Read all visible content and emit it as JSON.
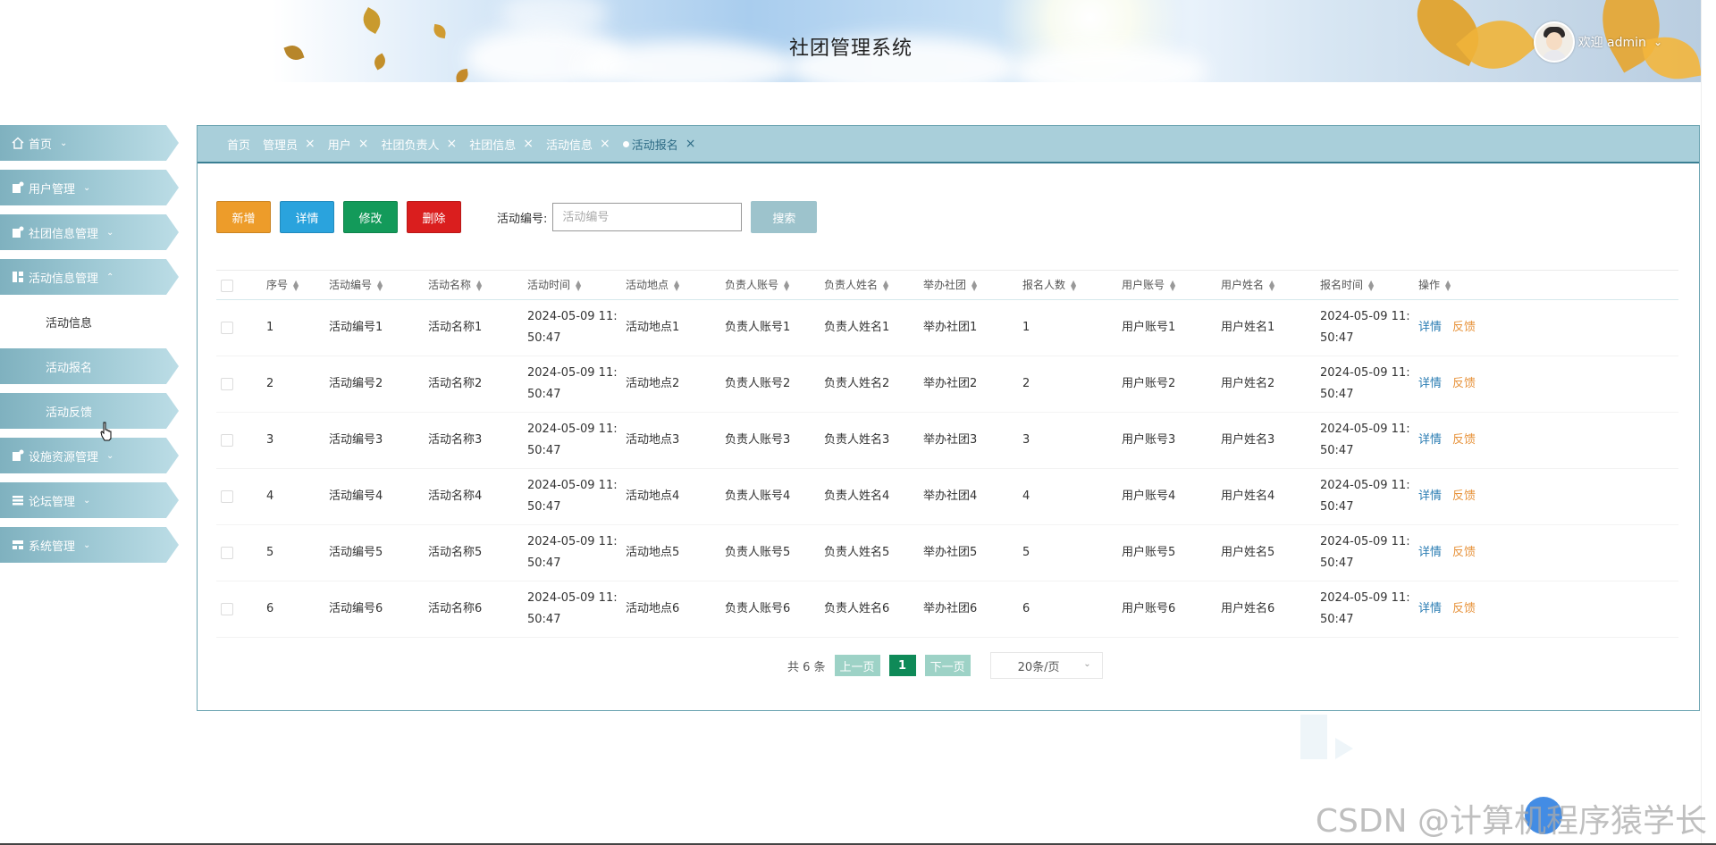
{
  "app": {
    "title": "社团管理系统",
    "welcome": "欢迎 admin"
  },
  "sidebar": {
    "items": [
      {
        "label": "首页",
        "icon": "home-icon"
      },
      {
        "label": "用户管理",
        "icon": "user-icon"
      },
      {
        "label": "社团信息管理",
        "icon": "club-icon"
      },
      {
        "label": "活动信息管理",
        "icon": "grid-icon"
      },
      {
        "label": "设施资源管理",
        "icon": "facility-icon"
      },
      {
        "label": "论坛管理",
        "icon": "list-icon"
      },
      {
        "label": "系统管理",
        "icon": "system-icon"
      }
    ],
    "submenu": [
      {
        "label": "活动信息"
      },
      {
        "label": "活动报名"
      },
      {
        "label": "活动反馈"
      }
    ]
  },
  "tabs": [
    {
      "label": "首页"
    },
    {
      "label": "管理员"
    },
    {
      "label": "用户"
    },
    {
      "label": "社团负责人"
    },
    {
      "label": "社团信息"
    },
    {
      "label": "活动信息"
    },
    {
      "label": "活动报名"
    }
  ],
  "toolbar": {
    "add": "新增",
    "detail": "详情",
    "edit": "修改",
    "delete": "删除",
    "search_label": "活动编号:",
    "search_placeholder": "活动编号",
    "search_button": "搜索"
  },
  "table": {
    "headers": [
      "序号",
      "活动编号",
      "活动名称",
      "活动时间",
      "活动地点",
      "负责人账号",
      "负责人姓名",
      "举办社团",
      "报名人数",
      "用户账号",
      "用户姓名",
      "报名时间",
      "操作"
    ],
    "rows": [
      {
        "seq": "1",
        "code": "活动编号1",
        "name": "活动名称1",
        "time1": "2024-05-09 11:",
        "time2": "50:47",
        "place": "活动地点1",
        "leader_acc": "负责人账号1",
        "leader_name": "负责人姓名1",
        "club": "举办社团1",
        "count": "1",
        "user_acc": "用户账号1",
        "user_name": "用户姓名1",
        "rtime1": "2024-05-09 11:",
        "rtime2": "50:47",
        "op_detail": "详情",
        "op_feedback": "反馈"
      },
      {
        "seq": "2",
        "code": "活动编号2",
        "name": "活动名称2",
        "time1": "2024-05-09 11:",
        "time2": "50:47",
        "place": "活动地点2",
        "leader_acc": "负责人账号2",
        "leader_name": "负责人姓名2",
        "club": "举办社团2",
        "count": "2",
        "user_acc": "用户账号2",
        "user_name": "用户姓名2",
        "rtime1": "2024-05-09 11:",
        "rtime2": "50:47",
        "op_detail": "详情",
        "op_feedback": "反馈"
      },
      {
        "seq": "3",
        "code": "活动编号3",
        "name": "活动名称3",
        "time1": "2024-05-09 11:",
        "time2": "50:47",
        "place": "活动地点3",
        "leader_acc": "负责人账号3",
        "leader_name": "负责人姓名3",
        "club": "举办社团3",
        "count": "3",
        "user_acc": "用户账号3",
        "user_name": "用户姓名3",
        "rtime1": "2024-05-09 11:",
        "rtime2": "50:47",
        "op_detail": "详情",
        "op_feedback": "反馈"
      },
      {
        "seq": "4",
        "code": "活动编号4",
        "name": "活动名称4",
        "time1": "2024-05-09 11:",
        "time2": "50:47",
        "place": "活动地点4",
        "leader_acc": "负责人账号4",
        "leader_name": "负责人姓名4",
        "club": "举办社团4",
        "count": "4",
        "user_acc": "用户账号4",
        "user_name": "用户姓名4",
        "rtime1": "2024-05-09 11:",
        "rtime2": "50:47",
        "op_detail": "详情",
        "op_feedback": "反馈"
      },
      {
        "seq": "5",
        "code": "活动编号5",
        "name": "活动名称5",
        "time1": "2024-05-09 11:",
        "time2": "50:47",
        "place": "活动地点5",
        "leader_acc": "负责人账号5",
        "leader_name": "负责人姓名5",
        "club": "举办社团5",
        "count": "5",
        "user_acc": "用户账号5",
        "user_name": "用户姓名5",
        "rtime1": "2024-05-09 11:",
        "rtime2": "50:47",
        "op_detail": "详情",
        "op_feedback": "反馈"
      },
      {
        "seq": "6",
        "code": "活动编号6",
        "name": "活动名称6",
        "time1": "2024-05-09 11:",
        "time2": "50:47",
        "place": "活动地点6",
        "leader_acc": "负责人账号6",
        "leader_name": "负责人姓名6",
        "club": "举办社团6",
        "count": "6",
        "user_acc": "用户账号6",
        "user_name": "用户姓名6",
        "rtime1": "2024-05-09 11:",
        "rtime2": "50:47",
        "op_detail": "详情",
        "op_feedback": "反馈"
      }
    ]
  },
  "pagination": {
    "total": "共 6 条",
    "prev": "上一页",
    "current": "1",
    "next": "下一页",
    "page_size": "20条/页"
  },
  "watermark": "CSDN @计算机程序猿学长",
  "colors": {
    "accent_teal": "#3b7f93",
    "btn_add": "#ed9c2a",
    "btn_detail": "#2aa3dd",
    "btn_edit": "#139a5a",
    "btn_delete": "#da1e1e",
    "link_detail": "#2b7db3",
    "link_feedback": "#e7923a"
  }
}
